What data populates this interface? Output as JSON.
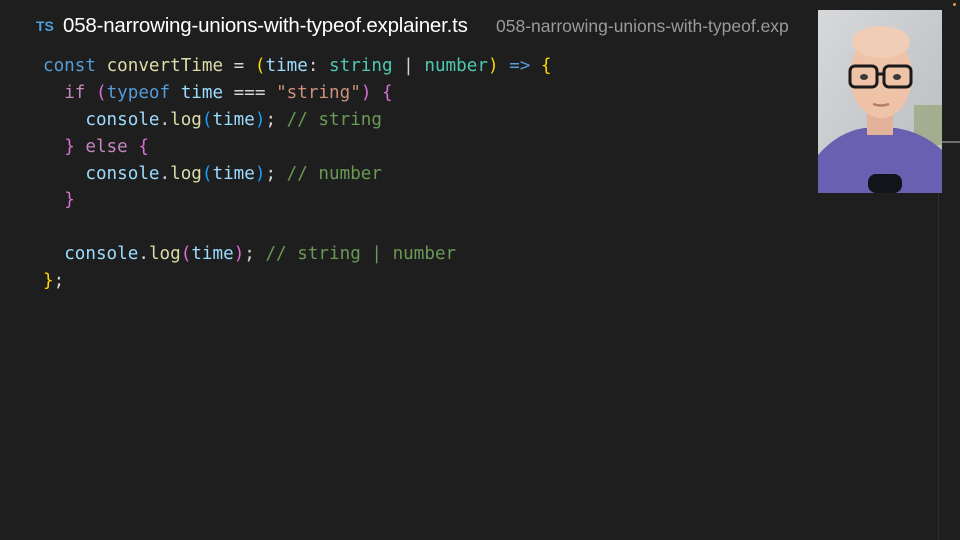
{
  "tab": {
    "language_badge": "TS",
    "file_name": "058-narrowing-unions-with-typeof.explainer.ts",
    "file_path": "058-narrowing-unions-with-typeof.exp"
  },
  "code": {
    "line1": {
      "const": "const",
      "name": "convertTime",
      "eq": " = ",
      "open_paren": "(",
      "param": "time",
      "colon": ": ",
      "type1": "string",
      "pipe": " | ",
      "type2": "number",
      "close_paren": ")",
      "arrow": " => ",
      "open_brace": "{"
    },
    "line2": {
      "if": "if",
      "open_paren": "(",
      "typeof": "typeof",
      "var": "time",
      "op": " === ",
      "str": "\"string\"",
      "close_paren": ")",
      "open_brace": "{"
    },
    "line3": {
      "obj": "console",
      "dot": ".",
      "fn": "log",
      "open_paren": "(",
      "arg": "time",
      "close_paren": ")",
      "semi": "; ",
      "comment": "// string"
    },
    "line4": {
      "close_brace": "}",
      "else": "else",
      "open_brace": "{"
    },
    "line5": {
      "obj": "console",
      "dot": ".",
      "fn": "log",
      "open_paren": "(",
      "arg": "time",
      "close_paren": ")",
      "semi": "; ",
      "comment": "// number"
    },
    "line6": {
      "close_brace": "}"
    },
    "line8": {
      "obj": "console",
      "dot": ".",
      "fn": "log",
      "open_paren": "(",
      "arg": "time",
      "close_paren": ")",
      "semi": "; ",
      "comment": "// string | number"
    },
    "line9": {
      "close_brace": "}",
      "semi": ";"
    }
  },
  "webcam": {
    "subject": "presenter-webcam-feed"
  },
  "colors": {
    "background": "#1e1e1e",
    "keyword": "#569cd6",
    "control": "#c586c0",
    "function": "#dcdcaa",
    "variable": "#9cdcfe",
    "type": "#4ec9b0",
    "string": "#ce9178",
    "comment": "#6a9955",
    "bracket_gold": "#ffd700"
  }
}
